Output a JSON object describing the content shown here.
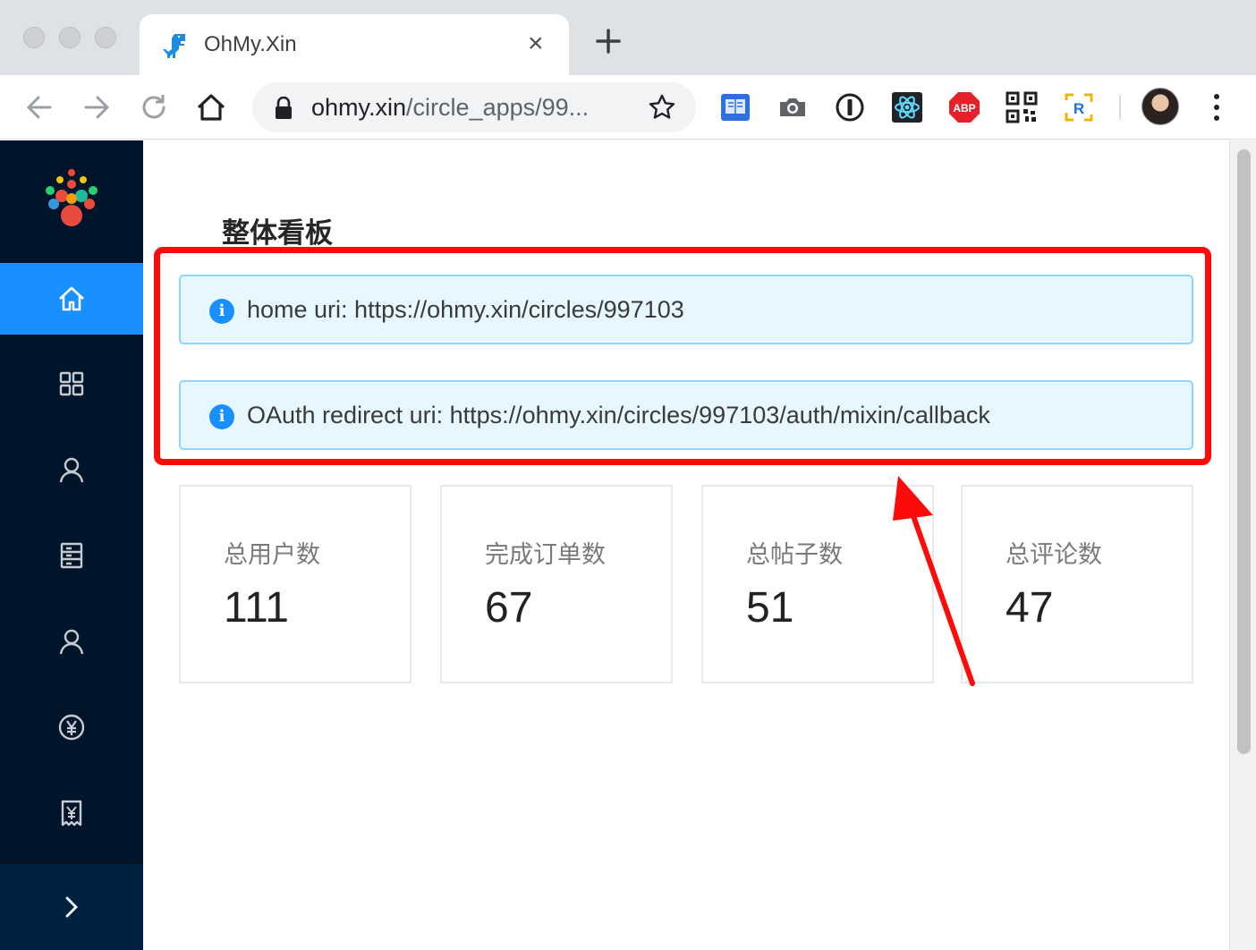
{
  "browser": {
    "tab_title": "OhMy.Xin",
    "tab_close": "×",
    "url_host": "ohmy.xin",
    "url_path": "/circle_apps/99..."
  },
  "app": {
    "page_title": "整体看板",
    "alerts": [
      {
        "text": "home uri: https://ohmy.xin/circles/997103"
      },
      {
        "text": "OAuth redirect uri: https://ohmy.xin/circles/997103/auth/mixin/callback"
      }
    ],
    "stats": [
      {
        "label": "总用户数",
        "value": "111"
      },
      {
        "label": "完成订单数",
        "value": "67"
      },
      {
        "label": "总帖子数",
        "value": "51"
      },
      {
        "label": "总评论数",
        "value": "47"
      }
    ],
    "sidebar_icons": [
      "home-icon",
      "appstore-icon",
      "user-icon",
      "profile-icon",
      "user-icon",
      "yuan-circle-icon",
      "bill-icon",
      "right-chevron-icon"
    ],
    "active_nav": "home"
  },
  "colors": {
    "sidebar_bg": "#001529",
    "active": "#1890ff",
    "alert_bg": "#e6f7ff",
    "alert_border": "#91d5ff",
    "annotation": "#ff0a0a"
  }
}
